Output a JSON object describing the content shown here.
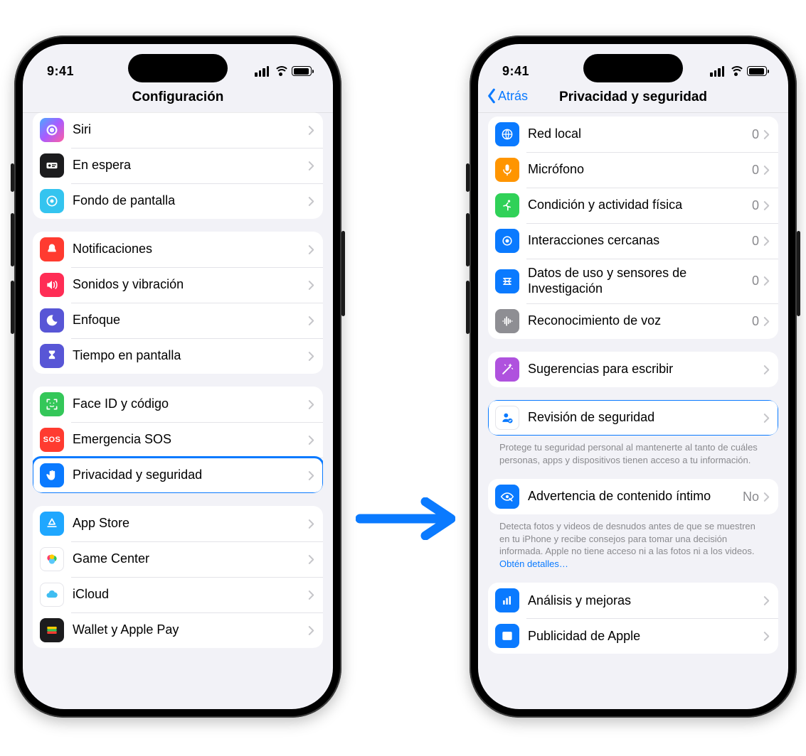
{
  "status": {
    "time": "9:41"
  },
  "left": {
    "title": "Configuración",
    "groups": [
      {
        "rows": [
          {
            "icon": "siri-icon",
            "bg": "bg-siri",
            "label": "Siri"
          },
          {
            "icon": "standby-icon",
            "bg": "bg-black",
            "label": "En espera"
          },
          {
            "icon": "wallpaper-icon",
            "bg": "bg-cyan",
            "label": "Fondo de pantalla"
          }
        ]
      },
      {
        "rows": [
          {
            "icon": "bell-icon",
            "bg": "bg-red",
            "label": "Notificaciones"
          },
          {
            "icon": "speaker-icon",
            "bg": "bg-pink",
            "label": "Sonidos y vibración"
          },
          {
            "icon": "moon-icon",
            "bg": "bg-indigo",
            "label": "Enfoque"
          },
          {
            "icon": "hourglass-icon",
            "bg": "bg-hour",
            "label": "Tiempo en pantalla"
          }
        ]
      },
      {
        "rows": [
          {
            "icon": "faceid-icon",
            "bg": "bg-green",
            "label": "Face ID y código"
          },
          {
            "icon": "sos-icon",
            "bg": "bg-sos",
            "label": "Emergencia SOS",
            "sos": "SOS"
          },
          {
            "icon": "hand-icon",
            "bg": "bg-blue",
            "label": "Privacidad y seguridad",
            "highlight": true
          }
        ]
      },
      {
        "rows": [
          {
            "icon": "appstore-icon",
            "bg": "bg-appstore",
            "label": "App Store"
          },
          {
            "icon": "gamecenter-icon",
            "bg": "bg-gc",
            "label": "Game Center"
          },
          {
            "icon": "icloud-icon",
            "bg": "bg-icloud",
            "label": "iCloud"
          },
          {
            "icon": "wallet-icon",
            "bg": "bg-wallet",
            "label": "Wallet y Apple Pay"
          }
        ]
      }
    ]
  },
  "right": {
    "back": "Atrás",
    "title": "Privacidad y seguridad",
    "groups": [
      {
        "rows": [
          {
            "icon": "globe-icon",
            "bg": "bg-blue",
            "label": "Red local",
            "detail": "0"
          },
          {
            "icon": "mic-icon",
            "bg": "bg-orange",
            "label": "Micrófono",
            "detail": "0"
          },
          {
            "icon": "fitness-icon",
            "bg": "bg-teal",
            "label": "Condición y actividad física",
            "detail": "0"
          },
          {
            "icon": "nearby-icon",
            "bg": "bg-blue",
            "label": "Interacciones cercanas",
            "detail": "0"
          },
          {
            "icon": "research-icon",
            "bg": "bg-blue",
            "label": "Datos de uso y sensores de Investigación",
            "detail": "0"
          },
          {
            "icon": "voice-icon",
            "bg": "bg-grey",
            "label": "Reconocimiento de voz",
            "detail": "0"
          }
        ]
      },
      {
        "rows": [
          {
            "icon": "wand-icon",
            "bg": "bg-purple",
            "label": "Sugerencias para escribir"
          }
        ]
      },
      {
        "rows": [
          {
            "icon": "safetycheck-icon",
            "bg": "white",
            "label": "Revisión de seguridad",
            "highlight": true
          }
        ],
        "footer": "Protege tu seguridad personal al mantenerte al tanto de cuáles personas, apps y dispositivos tienen acceso a tu información."
      },
      {
        "rows": [
          {
            "icon": "eye-icon",
            "bg": "bg-blue",
            "label": "Advertencia de contenido íntimo",
            "detail": "No"
          }
        ],
        "footer": "Detecta fotos y videos de desnudos antes de que se muestren en tu iPhone y recibe consejos para tomar una decisión informada. Apple no tiene acceso ni a las fotos ni a los videos. ",
        "footerLink": "Obtén detalles…"
      },
      {
        "rows": [
          {
            "icon": "analytics-icon",
            "bg": "bg-blue",
            "label": "Análisis y mejoras"
          },
          {
            "icon": "ads-icon",
            "bg": "bg-blue",
            "label": "Publicidad de Apple"
          }
        ]
      }
    ]
  }
}
